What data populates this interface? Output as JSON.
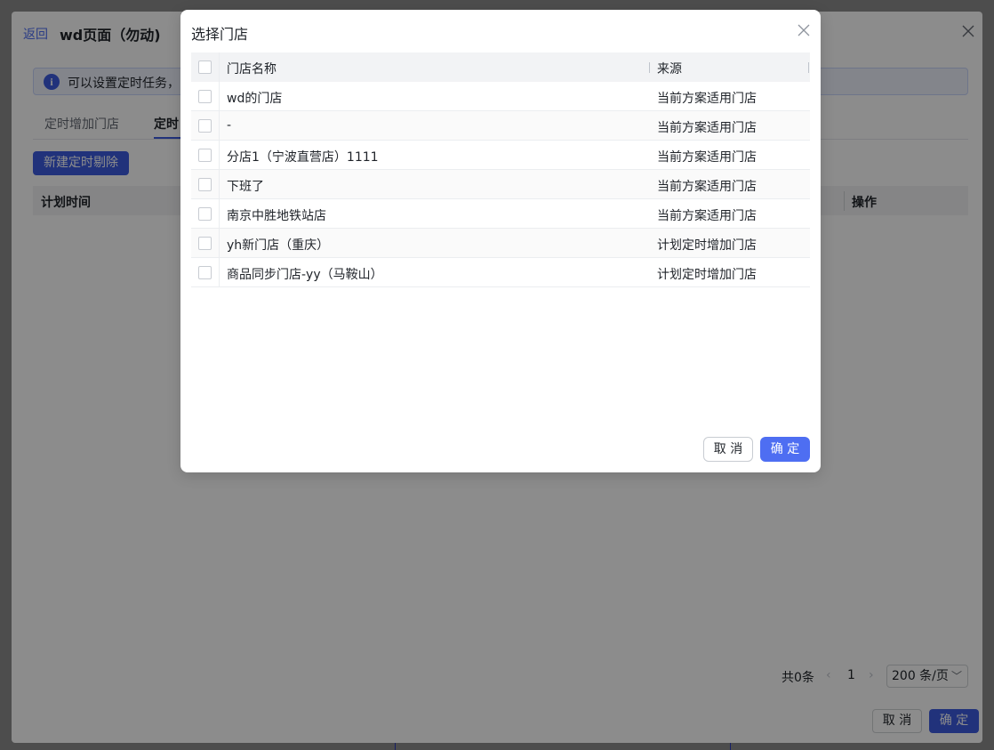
{
  "background_page": {
    "back_label": "返回",
    "title": "wd页面（勿动)",
    "info_text": "可以设置定时任务，",
    "info_icon": "info-icon",
    "tabs": [
      {
        "label": "定时增加门店"
      },
      {
        "label": "定时"
      }
    ],
    "new_button_label": "新建定时剔除",
    "table_headers": [
      "计划时间",
      "操作"
    ],
    "pagination": {
      "total_text": "共0条",
      "prev": "‹",
      "current_page": "1",
      "next": "›",
      "page_size": "200 条/页"
    },
    "footer": {
      "cancel_label": "取 消",
      "ok_label": "确 定"
    }
  },
  "modal": {
    "title": "选择门店",
    "columns": [
      "门店名称",
      "来源"
    ],
    "rows": [
      {
        "name": "wd的门店",
        "source": "当前方案适用门店"
      },
      {
        "name": "-",
        "source": "当前方案适用门店"
      },
      {
        "name": "分店1（宁波直营店）1111",
        "source": "当前方案适用门店"
      },
      {
        "name": "下班了",
        "source": "当前方案适用门店"
      },
      {
        "name": "南京中胜地铁站店",
        "source": "当前方案适用门店"
      },
      {
        "name": "yh新门店（重庆）",
        "source": "计划定时增加门店"
      },
      {
        "name": "商品同步门店-yy（马鞍山）",
        "source": "计划定时增加门店"
      }
    ],
    "cancel_label": "取 消",
    "ok_label": "确 定"
  },
  "colors": {
    "primary": "#4e6ef2",
    "primary_dark": "#3d5ce0",
    "header_bg": "#f2f3f5"
  }
}
